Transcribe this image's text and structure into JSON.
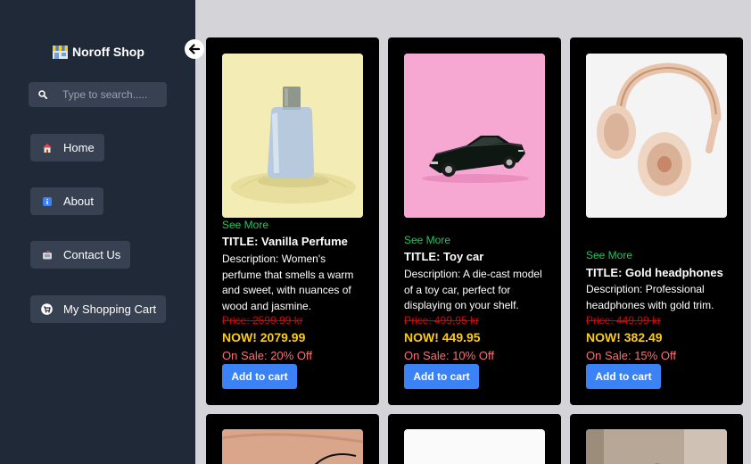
{
  "brand": {
    "name": "Noroff Shop",
    "icon": "store-icon"
  },
  "search": {
    "placeholder": "Type to search.....",
    "value": ""
  },
  "nav": [
    {
      "label": "Home",
      "icon": "home-icon"
    },
    {
      "label": "About",
      "icon": "info-icon"
    },
    {
      "label": "Contact Us",
      "icon": "mailbox-icon"
    },
    {
      "label": "My Shopping Cart",
      "icon": "cart-icon"
    }
  ],
  "colors": {
    "sidebar": "#1f2937",
    "accent_blue": "#3b82f6",
    "see_more_green": "#22c55e",
    "now_price_yellow": "#facc15",
    "old_price_red": "#e00000",
    "sale_red": "#f87171"
  },
  "products": [
    {
      "see_more": "See More",
      "title": "TITLE: Vanilla Perfume",
      "description": "Description: Women's perfume that smells a warm and sweet, with nuances of wood and jasmine.",
      "old_price": "Price: 2599.99 kr",
      "now_price": "NOW! 2079.99",
      "sale": "On Sale: 20% Off",
      "button": "Add to cart",
      "image": "perfume-bottle"
    },
    {
      "see_more": "See More",
      "title": "TITLE: Toy car",
      "description": "Description: A die-cast model of a toy car, perfect for displaying on your shelf.",
      "old_price": "Price: 499.95 kr",
      "now_price": "NOW! 449.95",
      "sale": "On Sale: 10% Off",
      "button": "Add to cart",
      "image": "toy-car"
    },
    {
      "see_more": "See More",
      "title": "TITLE: Gold headphones",
      "description": "Description: Professional headphones with gold trim.",
      "old_price": "Price: 449.99 kr",
      "now_price": "NOW! 382.49",
      "sale": "On Sale: 15% Off",
      "button": "Add to cart",
      "image": "headphones"
    }
  ]
}
